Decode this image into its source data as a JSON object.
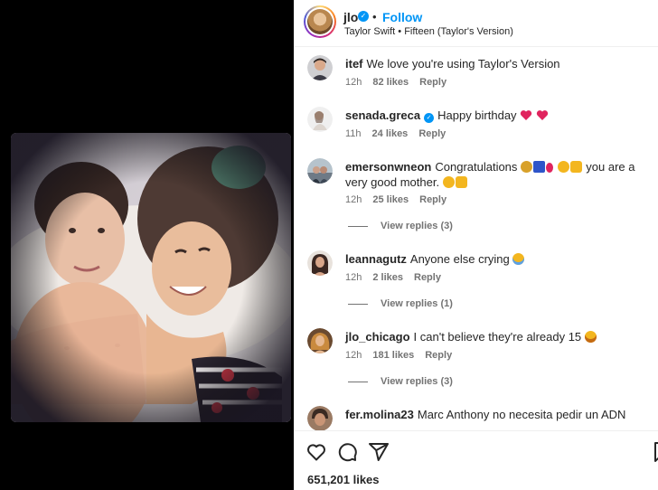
{
  "post": {
    "author": "jlo",
    "verified": true,
    "dot": "•",
    "follow_label": "Follow",
    "audio": "Taylor Swift • Fifteen (Taylor's Version)",
    "likes": "651,201 likes"
  },
  "comments": [
    {
      "user": "itef",
      "verified": false,
      "text": "We love you're using Taylor's Version",
      "time": "12h",
      "likes": "82 likes",
      "reply": "Reply"
    },
    {
      "user": "senada.greca",
      "verified": true,
      "text": "Happy birthday",
      "time": "11h",
      "likes": "24 likes",
      "reply": "Reply"
    },
    {
      "user": "emersonwneon",
      "verified": false,
      "text": "Congratulations",
      "text2": "you are a very good mother.",
      "time": "12h",
      "likes": "25 likes",
      "reply": "Reply",
      "view_replies": "View replies (3)"
    },
    {
      "user": "leannagutz",
      "verified": false,
      "text": "Anyone else crying",
      "time": "12h",
      "likes": "2 likes",
      "reply": "Reply",
      "view_replies": "View replies (1)"
    },
    {
      "user": "jlo_chicago",
      "verified": false,
      "text": "I can't believe they're already 15",
      "time": "12h",
      "likes": "181 likes",
      "reply": "Reply",
      "view_replies": "View replies (3)"
    },
    {
      "user": "fer.molina23",
      "verified": false,
      "text": "Marc Anthony no necesita pedir un ADN"
    }
  ],
  "icons": {
    "like": "heart-outline-icon",
    "comment": "speech-bubble-icon",
    "share": "paper-plane-icon",
    "save": "bookmark-icon",
    "more": "more-dots-icon"
  },
  "colors": {
    "link_blue": "#0095f6",
    "secondary_text": "#737373",
    "heart_red": "#e0245e"
  }
}
